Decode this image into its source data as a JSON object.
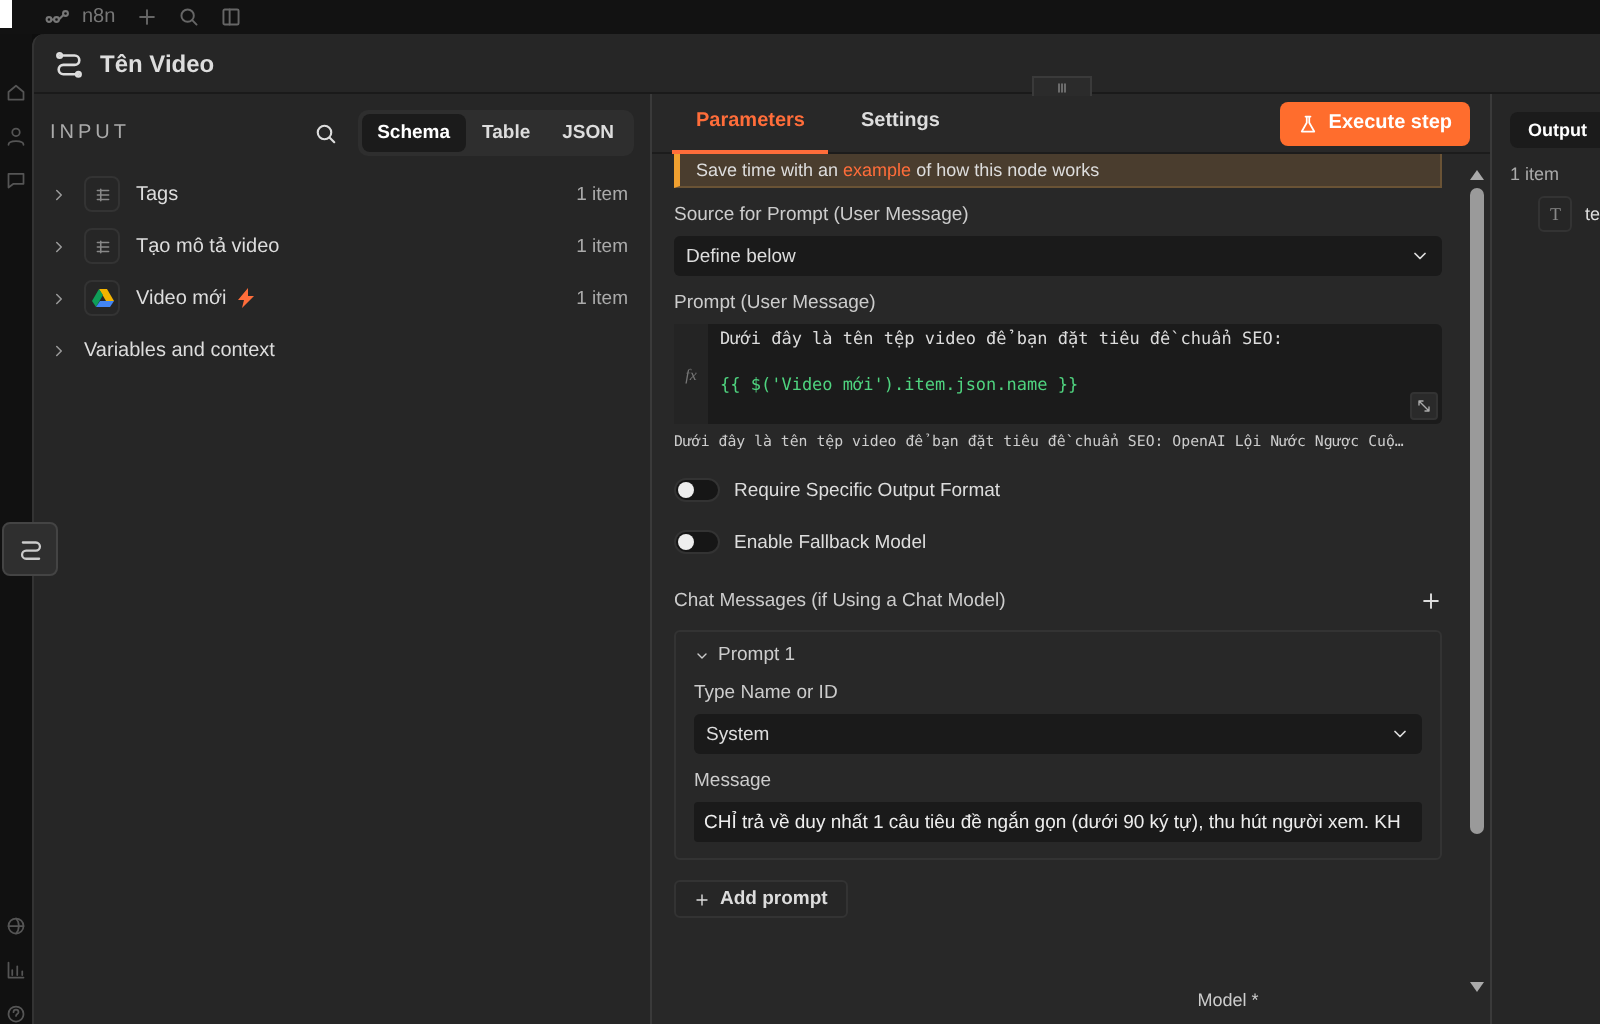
{
  "app_bar": {
    "logo": "n8n"
  },
  "window": {
    "title": "Tên Video"
  },
  "input_panel": {
    "title": "INPUT",
    "view_tabs": [
      {
        "label": "Schema",
        "selected": true
      },
      {
        "label": "Table",
        "selected": false
      },
      {
        "label": "JSON",
        "selected": false
      }
    ],
    "items": [
      {
        "kind": "node",
        "label": "Tags",
        "count": "1 item",
        "trigger": false
      },
      {
        "kind": "node",
        "label": "Tạo mô tả video",
        "count": "1 item",
        "trigger": false
      },
      {
        "kind": "drive",
        "label": "Video mới",
        "count": "1 item",
        "trigger": true
      },
      {
        "kind": "section",
        "label": "Variables and context"
      }
    ]
  },
  "parameters_panel": {
    "tabs": [
      {
        "label": "Parameters",
        "selected": true
      },
      {
        "label": "Settings",
        "selected": false
      }
    ],
    "execute_button": "Execute step",
    "notice": {
      "before": "Save time with an ",
      "link": "example",
      "after": " of how this node works"
    },
    "source_label": "Source for Prompt (User Message)",
    "source_value": "Define below",
    "prompt_label": "Prompt (User Message)",
    "expression_marker": "fx",
    "prompt_lines": [
      {
        "kind": "text",
        "text": "Dưới đây là tên tệp video để bạn đặt tiêu đề chuẩn SEO:"
      },
      {
        "kind": "expression",
        "text": "{{ $('Video mới').item.json.name }}"
      }
    ],
    "prompt_preview": "Dưới đây là tên tệp video để bạn đặt tiêu đề chuẩn SEO: OpenAI Lội Nước Ngược Cuộ…",
    "toggles": [
      {
        "label": "Require Specific Output Format",
        "on": false
      },
      {
        "label": "Enable Fallback Model",
        "on": false
      }
    ],
    "chat_messages_label": "Chat Messages (if Using a Chat Model)",
    "prompt_group": {
      "title": "Prompt 1",
      "expanded": true,
      "type_label": "Type Name or ID",
      "type_value": "System",
      "message_label": "Message",
      "message_value": "CHỈ trả về duy nhất 1 câu tiêu đề ngắn gọn (dưới 90 ký tự), thu hút người xem. KH"
    },
    "add_prompt_button": "Add prompt",
    "model_label": "Model *"
  },
  "output_panel": {
    "tabs": [
      {
        "label": "Output",
        "selected": true
      }
    ],
    "count": "1 item",
    "field_type": "T",
    "field": "te"
  }
}
